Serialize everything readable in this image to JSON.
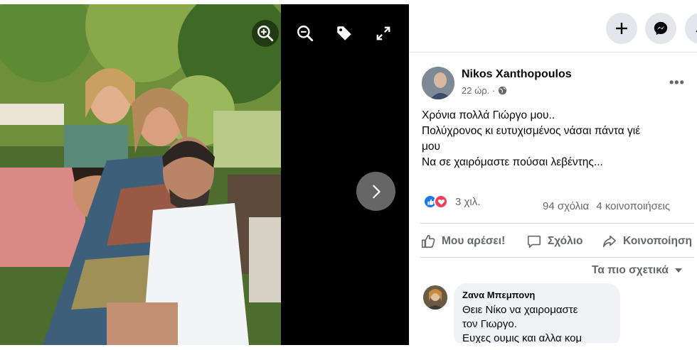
{
  "viewer": {
    "tools": [
      "zoom-in-icon",
      "zoom-out-icon",
      "tag-icon",
      "fullscreen-icon"
    ],
    "next_icon": "chevron-right-icon"
  },
  "topbar": {
    "buttons": [
      "plus-icon",
      "messenger-icon",
      "bell-icon"
    ]
  },
  "post": {
    "author": "Nikos Xanthopoulos",
    "time": "22 ώρ. ·",
    "audience_icon": "globe-icon",
    "text_lines": [
      "Χρόνια πολλά Γιώργο μου..",
      "Πολύχρονος κι ευτυχισμένος νάσαι πάντα γιέ",
      "μου",
      "Να σε χαιρόμαστε πούσαι λεβέντης..."
    ],
    "reaction_count": "3 χιλ.",
    "comments_count": "94 σχόλια",
    "shares_count": "4 κοινοποιήσεις",
    "actions": {
      "like": "Μου αρέσει!",
      "comment": "Σχόλιο",
      "share": "Κοινοποίηση"
    },
    "sort_label": "Τα πιο σχετικά"
  },
  "comment": {
    "author": "Ζανα Μπεμπονη",
    "lines": [
      "Θειε Νίκο να χαιρομαστε",
      "τον Γιωργο.",
      "Ευχες ουμις και αλλα κομ"
    ]
  },
  "colors": {
    "accent": "#1877f2",
    "love": "#f33e58",
    "secondary_text": "#65676b"
  }
}
